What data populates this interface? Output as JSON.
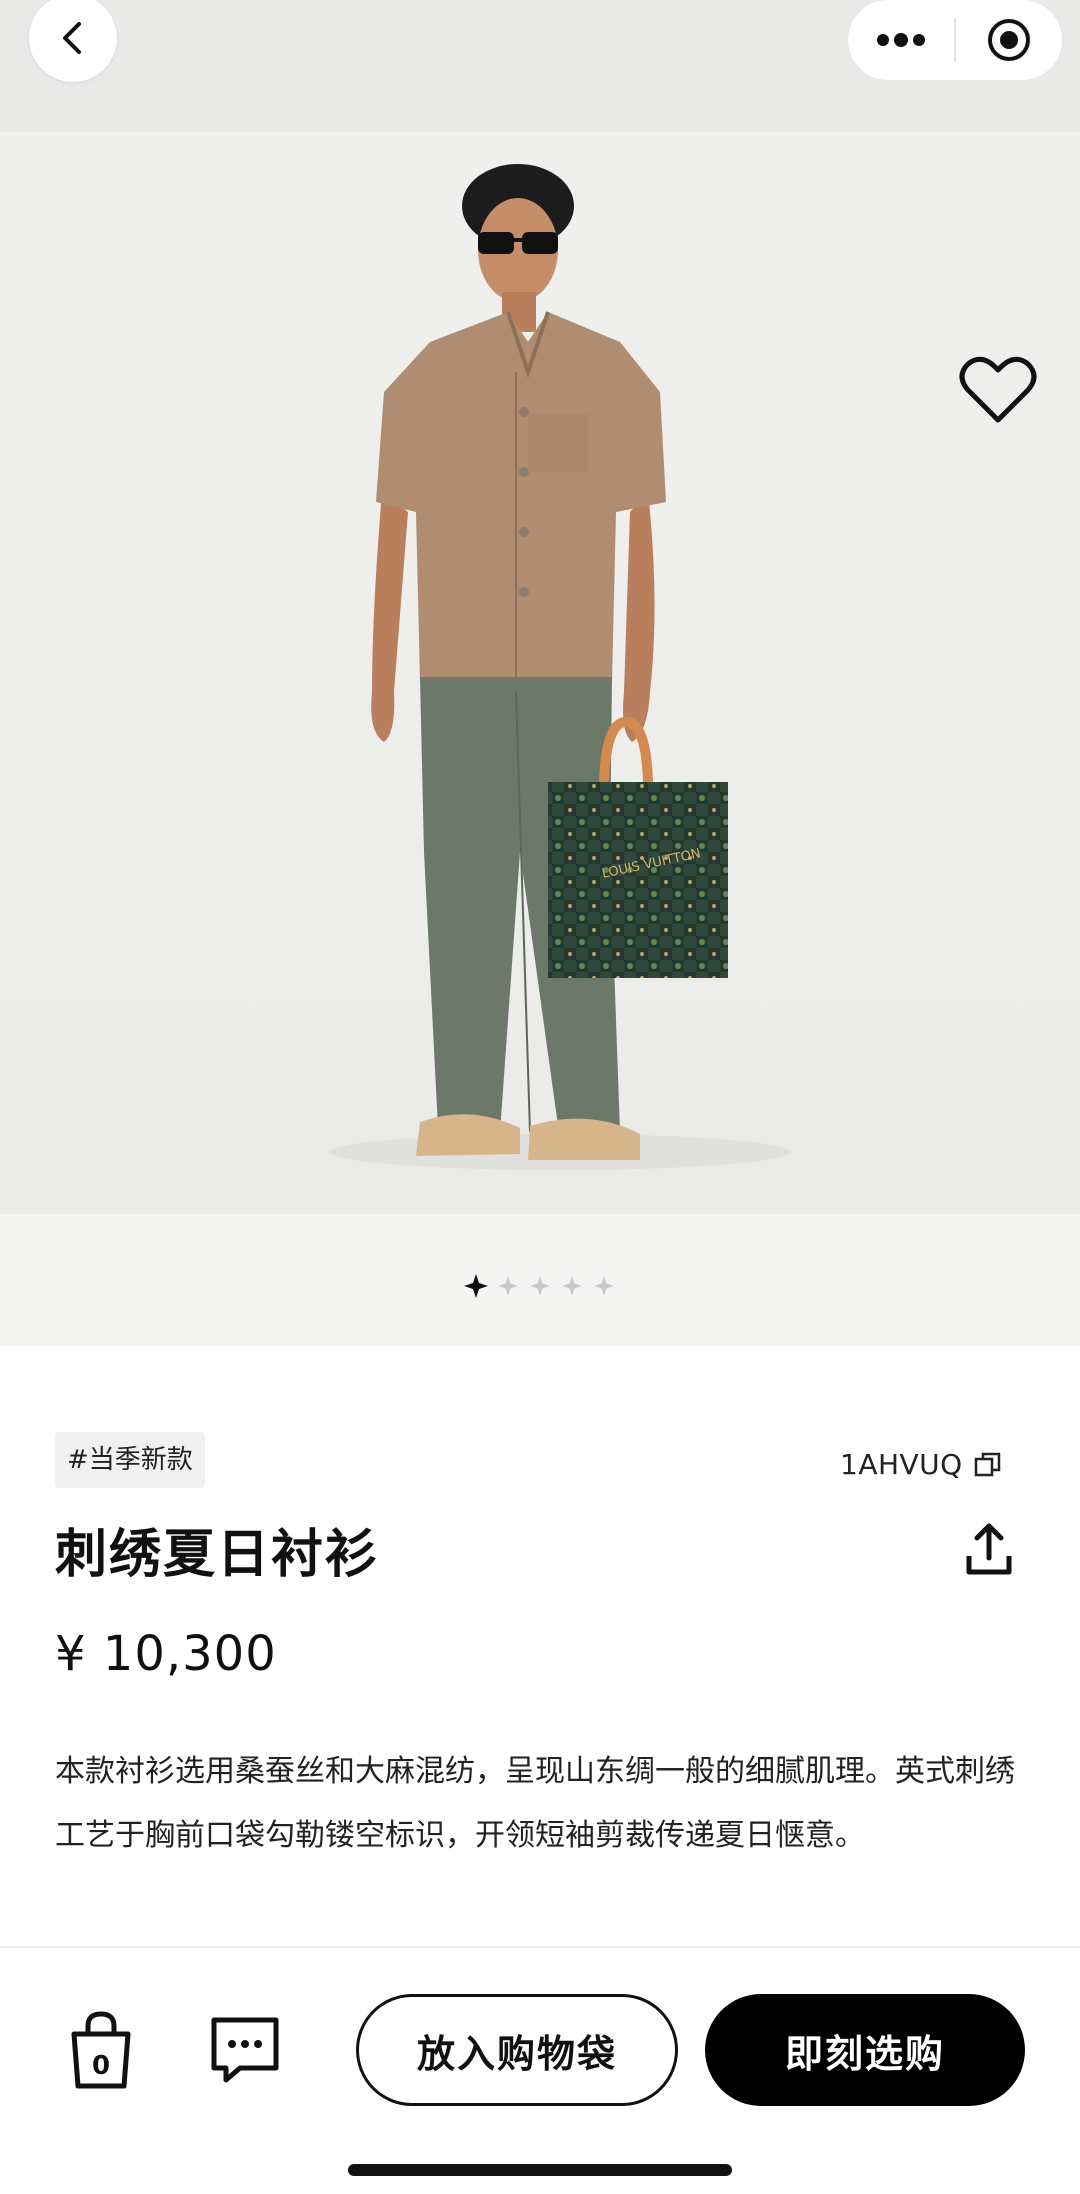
{
  "product": {
    "tag": "#当季新款",
    "sku": "1AHVUQ",
    "title": "刺绣夏日衬衫",
    "price": "¥ 10,300",
    "description": "本款衬衫选用桑蚕丝和大麻混纺，呈现山东绸一般的细腻肌理。英式刺绣工艺于胸前口袋勾勒镂空标识，开领短袖剪裁传递夏日惬意。"
  },
  "bag": {
    "count": "0"
  },
  "actions": {
    "add_to_bag": "放入购物袋",
    "buy_now": "即刻选购"
  },
  "carousel": {
    "total": 5,
    "active": 0
  },
  "hero_image": {
    "bag_print_text": "LOUIS VUITTON"
  },
  "icons": {
    "back": "chevron-left-icon",
    "more": "more-dots-icon",
    "target": "target-icon",
    "favorite": "heart-icon",
    "copy": "copy-icon",
    "share": "share-icon",
    "bag": "shopping-bag-icon",
    "chat": "chat-icon"
  },
  "colors": {
    "accent": "#000000",
    "background_topbar": "#e9e9e8",
    "hero_bg": "#ededeb"
  }
}
